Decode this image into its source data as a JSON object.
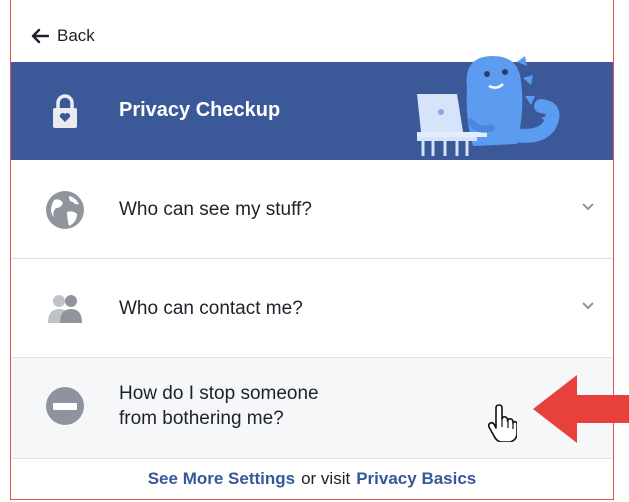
{
  "nav": {
    "back_label": "Back"
  },
  "header": {
    "title": "Privacy Checkup"
  },
  "options": [
    {
      "label": "Who can see my stuff?",
      "icon": "globe-icon"
    },
    {
      "label": "Who can contact me?",
      "icon": "people-icon"
    },
    {
      "label_line1": "How do I stop someone",
      "label_line2": "from bothering me?",
      "icon": "block-icon"
    }
  ],
  "footer": {
    "see_more": "See More Settings",
    "middle": "or visit",
    "privacy_basics": "Privacy Basics"
  },
  "colors": {
    "header_bg": "#3b5998",
    "link": "#365899",
    "annotation_arrow": "#e8514f"
  }
}
